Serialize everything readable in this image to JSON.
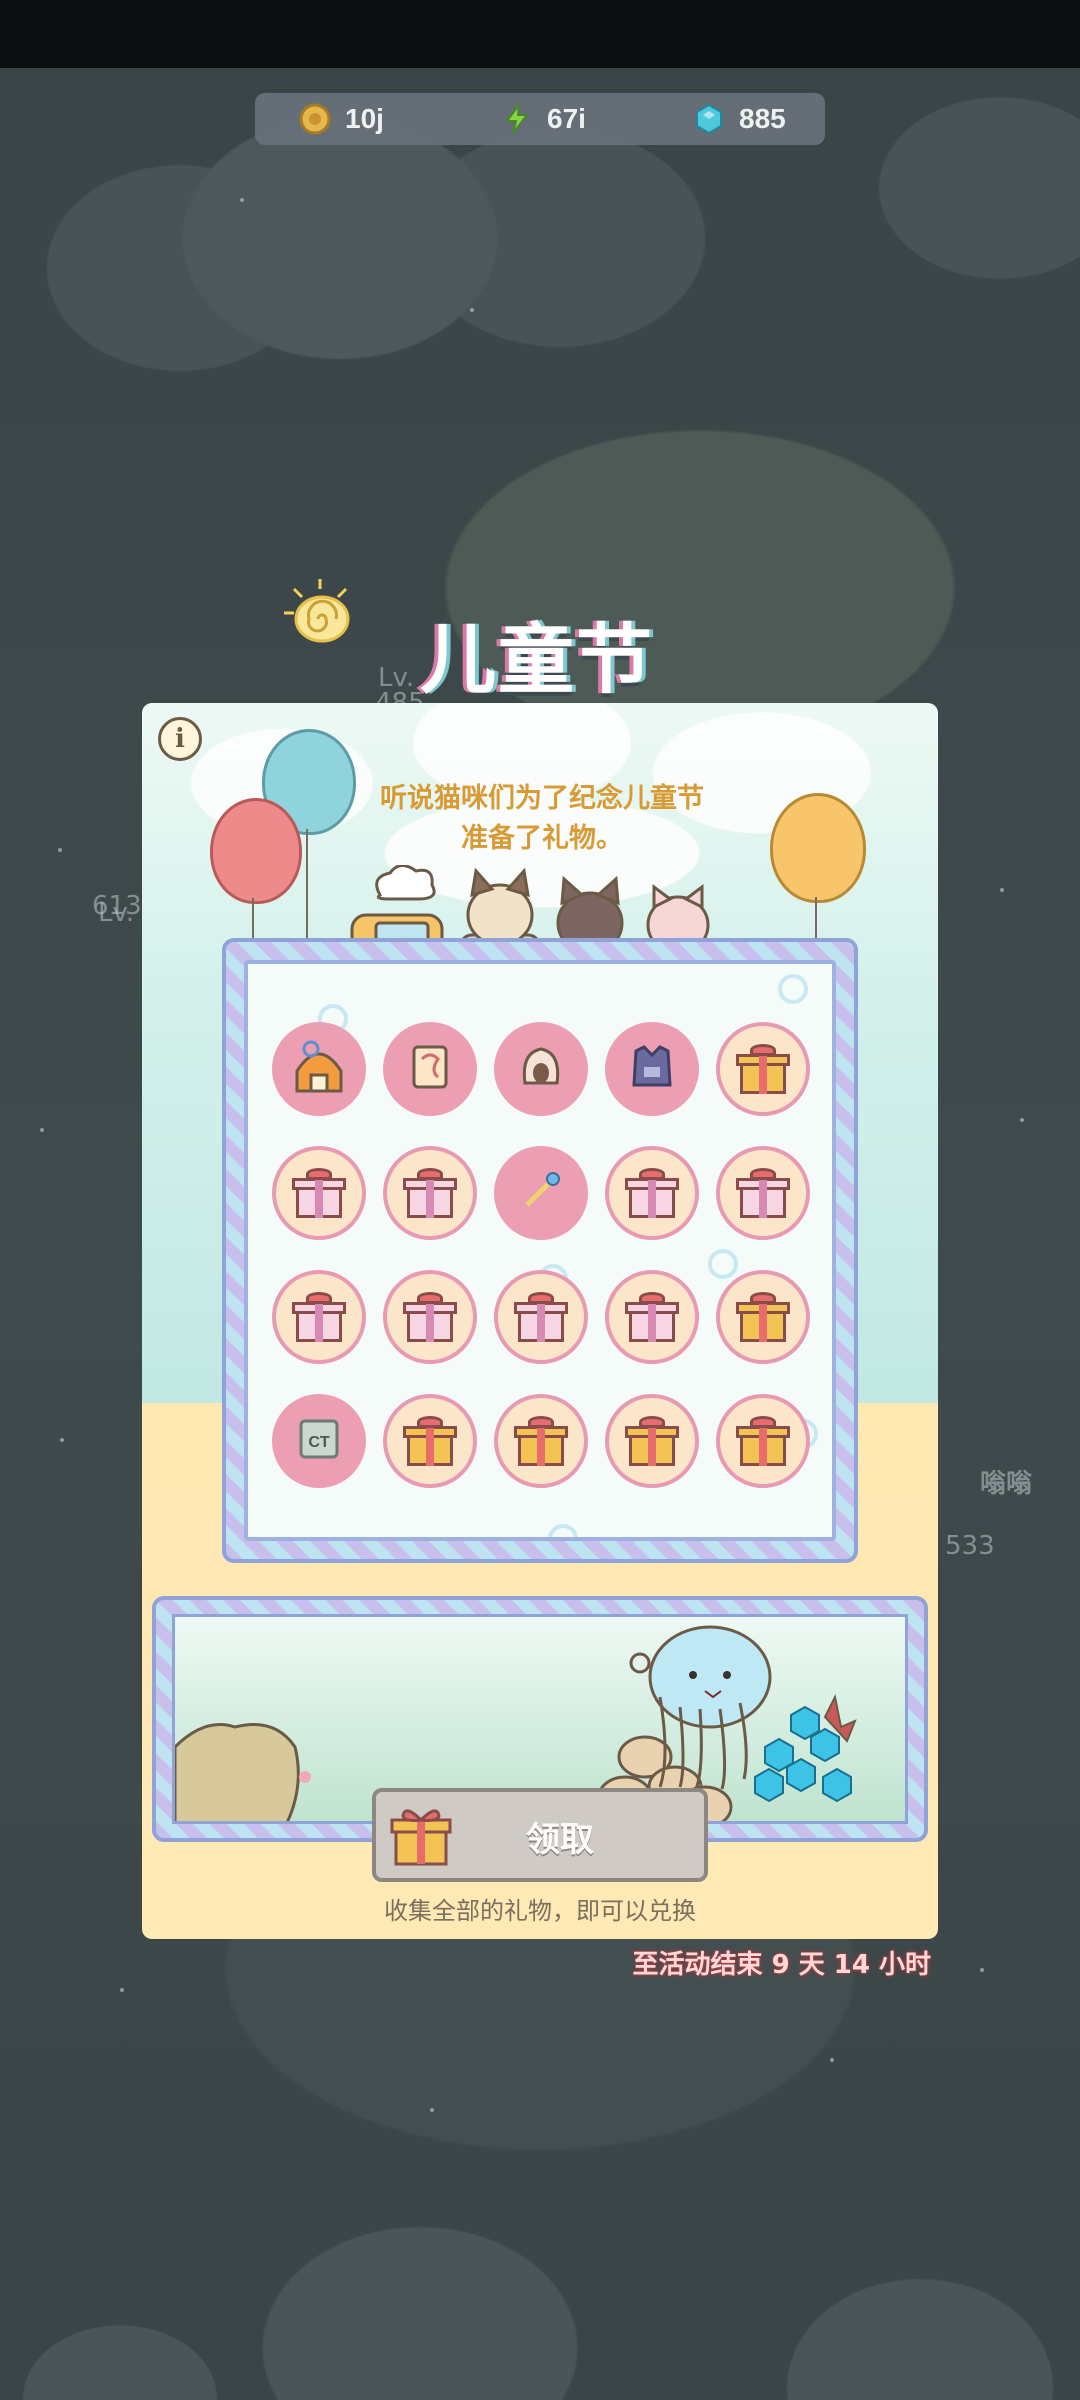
{
  "hud": {
    "coins": {
      "icon": "coin-icon",
      "value": "10j"
    },
    "energy": {
      "icon": "lightning-icon",
      "value": "67i"
    },
    "gems": {
      "icon": "gem-icon",
      "value": "885"
    }
  },
  "event": {
    "title": "儿童节",
    "intro_line1": "听说猫咪们为了纪念儿童节",
    "intro_line2": "准备了礼物。",
    "claim_label": "领取",
    "hint": "收集全部的礼物，即可以兑换",
    "timer": "至活动结束  9 天 14 小时"
  },
  "gifts": [
    {
      "type": "item",
      "icon": "cat-house-icon",
      "name": "cat-house"
    },
    {
      "type": "item",
      "icon": "scroll-icon",
      "name": "scroll"
    },
    {
      "type": "item",
      "icon": "shell-icon",
      "name": "shell"
    },
    {
      "type": "item",
      "icon": "vest-icon",
      "name": "vest"
    },
    {
      "type": "gift",
      "icon": "gift-gold-icon",
      "color": "gold"
    },
    {
      "type": "gift",
      "icon": "gift-pink-icon",
      "color": "pink"
    },
    {
      "type": "gift",
      "icon": "gift-pink-icon",
      "color": "pink"
    },
    {
      "type": "item",
      "icon": "wand-icon",
      "name": "wand"
    },
    {
      "type": "gift",
      "icon": "gift-pink-icon",
      "color": "pink"
    },
    {
      "type": "gift",
      "icon": "gift-pink-icon",
      "color": "pink"
    },
    {
      "type": "gift",
      "icon": "gift-pink-icon",
      "color": "pink"
    },
    {
      "type": "gift",
      "icon": "gift-pink-icon",
      "color": "pink"
    },
    {
      "type": "gift",
      "icon": "gift-pink-icon",
      "color": "pink"
    },
    {
      "type": "gift",
      "icon": "gift-pink-icon",
      "color": "pink"
    },
    {
      "type": "gift",
      "icon": "gift-gold-icon",
      "color": "gold"
    },
    {
      "type": "item",
      "icon": "ct-box-icon",
      "name": "ct-box"
    },
    {
      "type": "gift",
      "icon": "gift-gold-icon",
      "color": "gold"
    },
    {
      "type": "gift",
      "icon": "gift-gold-icon",
      "color": "gold"
    },
    {
      "type": "gift",
      "icon": "gift-gold-icon",
      "color": "gold"
    },
    {
      "type": "gift",
      "icon": "gift-gold-icon",
      "color": "gold"
    }
  ],
  "background_signs": [
    "Lv.",
    "485",
    "Lv.",
    "613",
    "533",
    "嗡嗡"
  ],
  "colors": {
    "accent_gold": "#d89a34",
    "gift_border": "#e89ab3",
    "timer_text": "#ffd9d9"
  }
}
